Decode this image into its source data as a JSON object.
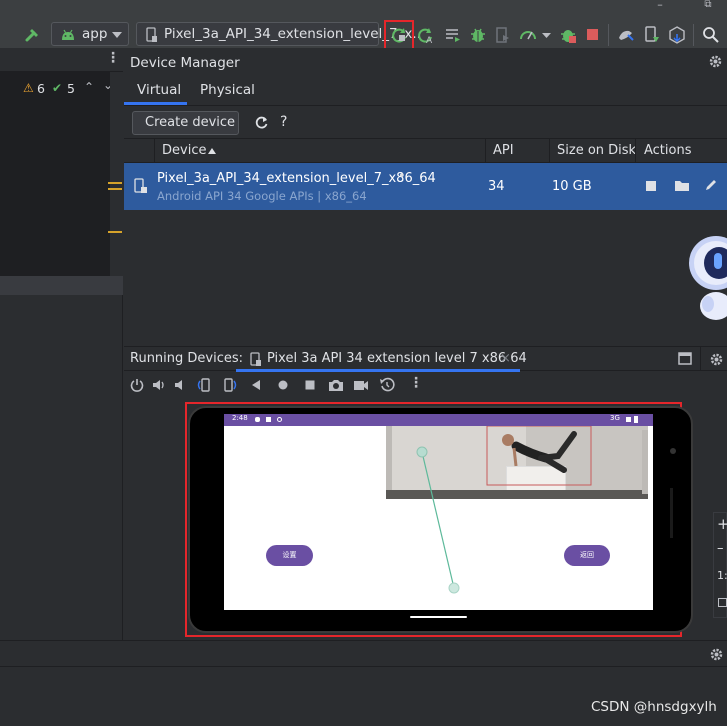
{
  "toolbar": {
    "build_icon": "hammer-icon",
    "config_label": "app",
    "device_label": "Pixel_3a_API_34_extension_level_7_x..",
    "window_min": "–",
    "window_restore": "⧉"
  },
  "left_panel": {
    "warnings_count": "6",
    "checks_count": "5"
  },
  "device_manager": {
    "title": "Device Manager",
    "tabs": [
      "Virtual",
      "Physical"
    ],
    "create_button": "Create device",
    "help": "?",
    "columns": {
      "device": "Device",
      "api": "API",
      "size": "Size on Disk",
      "actions": "Actions"
    },
    "device": {
      "name": "Pixel_3a_API_34_extension_level_7_x86_64",
      "status_dot": "•",
      "subtitle": "Android API 34 Google APIs | x86_64",
      "api": "34",
      "size": "10 GB"
    }
  },
  "running_devices": {
    "label": "Running Devices:",
    "tab_label": "Pixel 3a API 34 extension level 7 x86 64",
    "tab_close": "×",
    "phone": {
      "time": "2:48",
      "signal": "3G",
      "left_button": "设置",
      "right_button": "返回"
    }
  },
  "side_zoom": {
    "plus": "+",
    "minus": "–",
    "ratio": "1:"
  },
  "watermark": "CSDN @hnsdgxylh",
  "colors": {
    "accent_blue": "#3574f0",
    "selection_row": "#2e5b9e",
    "highlight_red": "#e5262b",
    "phone_purple": "#6a4fa3",
    "green_run": "#5fb865"
  }
}
